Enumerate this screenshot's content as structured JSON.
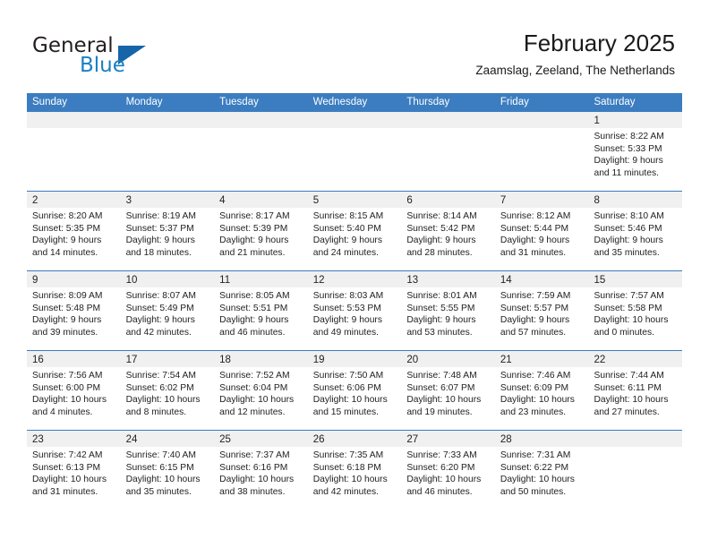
{
  "brand": {
    "name_top": "General",
    "name_bottom": "Blue",
    "triangle_color": "#1565a8",
    "blue_color": "#1b7fc4"
  },
  "header": {
    "title": "February 2025",
    "subtitle": "Zaamslag, Zeeland, The Netherlands"
  },
  "theme": {
    "header_bar_color": "#3b7dc0",
    "daynum_band_color": "#f0f0f0",
    "text_color": "#222222"
  },
  "weekday_headers": [
    "Sunday",
    "Monday",
    "Tuesday",
    "Wednesday",
    "Thursday",
    "Friday",
    "Saturday"
  ],
  "weeks": [
    [
      {
        "day": "",
        "sunrise": "",
        "sunset": "",
        "daylight_line1": "",
        "daylight_line2": ""
      },
      {
        "day": "",
        "sunrise": "",
        "sunset": "",
        "daylight_line1": "",
        "daylight_line2": ""
      },
      {
        "day": "",
        "sunrise": "",
        "sunset": "",
        "daylight_line1": "",
        "daylight_line2": ""
      },
      {
        "day": "",
        "sunrise": "",
        "sunset": "",
        "daylight_line1": "",
        "daylight_line2": ""
      },
      {
        "day": "",
        "sunrise": "",
        "sunset": "",
        "daylight_line1": "",
        "daylight_line2": ""
      },
      {
        "day": "",
        "sunrise": "",
        "sunset": "",
        "daylight_line1": "",
        "daylight_line2": ""
      },
      {
        "day": "1",
        "sunrise": "Sunrise: 8:22 AM",
        "sunset": "Sunset: 5:33 PM",
        "daylight_line1": "Daylight: 9 hours",
        "daylight_line2": "and 11 minutes."
      }
    ],
    [
      {
        "day": "2",
        "sunrise": "Sunrise: 8:20 AM",
        "sunset": "Sunset: 5:35 PM",
        "daylight_line1": "Daylight: 9 hours",
        "daylight_line2": "and 14 minutes."
      },
      {
        "day": "3",
        "sunrise": "Sunrise: 8:19 AM",
        "sunset": "Sunset: 5:37 PM",
        "daylight_line1": "Daylight: 9 hours",
        "daylight_line2": "and 18 minutes."
      },
      {
        "day": "4",
        "sunrise": "Sunrise: 8:17 AM",
        "sunset": "Sunset: 5:39 PM",
        "daylight_line1": "Daylight: 9 hours",
        "daylight_line2": "and 21 minutes."
      },
      {
        "day": "5",
        "sunrise": "Sunrise: 8:15 AM",
        "sunset": "Sunset: 5:40 PM",
        "daylight_line1": "Daylight: 9 hours",
        "daylight_line2": "and 24 minutes."
      },
      {
        "day": "6",
        "sunrise": "Sunrise: 8:14 AM",
        "sunset": "Sunset: 5:42 PM",
        "daylight_line1": "Daylight: 9 hours",
        "daylight_line2": "and 28 minutes."
      },
      {
        "day": "7",
        "sunrise": "Sunrise: 8:12 AM",
        "sunset": "Sunset: 5:44 PM",
        "daylight_line1": "Daylight: 9 hours",
        "daylight_line2": "and 31 minutes."
      },
      {
        "day": "8",
        "sunrise": "Sunrise: 8:10 AM",
        "sunset": "Sunset: 5:46 PM",
        "daylight_line1": "Daylight: 9 hours",
        "daylight_line2": "and 35 minutes."
      }
    ],
    [
      {
        "day": "9",
        "sunrise": "Sunrise: 8:09 AM",
        "sunset": "Sunset: 5:48 PM",
        "daylight_line1": "Daylight: 9 hours",
        "daylight_line2": "and 39 minutes."
      },
      {
        "day": "10",
        "sunrise": "Sunrise: 8:07 AM",
        "sunset": "Sunset: 5:49 PM",
        "daylight_line1": "Daylight: 9 hours",
        "daylight_line2": "and 42 minutes."
      },
      {
        "day": "11",
        "sunrise": "Sunrise: 8:05 AM",
        "sunset": "Sunset: 5:51 PM",
        "daylight_line1": "Daylight: 9 hours",
        "daylight_line2": "and 46 minutes."
      },
      {
        "day": "12",
        "sunrise": "Sunrise: 8:03 AM",
        "sunset": "Sunset: 5:53 PM",
        "daylight_line1": "Daylight: 9 hours",
        "daylight_line2": "and 49 minutes."
      },
      {
        "day": "13",
        "sunrise": "Sunrise: 8:01 AM",
        "sunset": "Sunset: 5:55 PM",
        "daylight_line1": "Daylight: 9 hours",
        "daylight_line2": "and 53 minutes."
      },
      {
        "day": "14",
        "sunrise": "Sunrise: 7:59 AM",
        "sunset": "Sunset: 5:57 PM",
        "daylight_line1": "Daylight: 9 hours",
        "daylight_line2": "and 57 minutes."
      },
      {
        "day": "15",
        "sunrise": "Sunrise: 7:57 AM",
        "sunset": "Sunset: 5:58 PM",
        "daylight_line1": "Daylight: 10 hours",
        "daylight_line2": "and 0 minutes."
      }
    ],
    [
      {
        "day": "16",
        "sunrise": "Sunrise: 7:56 AM",
        "sunset": "Sunset: 6:00 PM",
        "daylight_line1": "Daylight: 10 hours",
        "daylight_line2": "and 4 minutes."
      },
      {
        "day": "17",
        "sunrise": "Sunrise: 7:54 AM",
        "sunset": "Sunset: 6:02 PM",
        "daylight_line1": "Daylight: 10 hours",
        "daylight_line2": "and 8 minutes."
      },
      {
        "day": "18",
        "sunrise": "Sunrise: 7:52 AM",
        "sunset": "Sunset: 6:04 PM",
        "daylight_line1": "Daylight: 10 hours",
        "daylight_line2": "and 12 minutes."
      },
      {
        "day": "19",
        "sunrise": "Sunrise: 7:50 AM",
        "sunset": "Sunset: 6:06 PM",
        "daylight_line1": "Daylight: 10 hours",
        "daylight_line2": "and 15 minutes."
      },
      {
        "day": "20",
        "sunrise": "Sunrise: 7:48 AM",
        "sunset": "Sunset: 6:07 PM",
        "daylight_line1": "Daylight: 10 hours",
        "daylight_line2": "and 19 minutes."
      },
      {
        "day": "21",
        "sunrise": "Sunrise: 7:46 AM",
        "sunset": "Sunset: 6:09 PM",
        "daylight_line1": "Daylight: 10 hours",
        "daylight_line2": "and 23 minutes."
      },
      {
        "day": "22",
        "sunrise": "Sunrise: 7:44 AM",
        "sunset": "Sunset: 6:11 PM",
        "daylight_line1": "Daylight: 10 hours",
        "daylight_line2": "and 27 minutes."
      }
    ],
    [
      {
        "day": "23",
        "sunrise": "Sunrise: 7:42 AM",
        "sunset": "Sunset: 6:13 PM",
        "daylight_line1": "Daylight: 10 hours",
        "daylight_line2": "and 31 minutes."
      },
      {
        "day": "24",
        "sunrise": "Sunrise: 7:40 AM",
        "sunset": "Sunset: 6:15 PM",
        "daylight_line1": "Daylight: 10 hours",
        "daylight_line2": "and 35 minutes."
      },
      {
        "day": "25",
        "sunrise": "Sunrise: 7:37 AM",
        "sunset": "Sunset: 6:16 PM",
        "daylight_line1": "Daylight: 10 hours",
        "daylight_line2": "and 38 minutes."
      },
      {
        "day": "26",
        "sunrise": "Sunrise: 7:35 AM",
        "sunset": "Sunset: 6:18 PM",
        "daylight_line1": "Daylight: 10 hours",
        "daylight_line2": "and 42 minutes."
      },
      {
        "day": "27",
        "sunrise": "Sunrise: 7:33 AM",
        "sunset": "Sunset: 6:20 PM",
        "daylight_line1": "Daylight: 10 hours",
        "daylight_line2": "and 46 minutes."
      },
      {
        "day": "28",
        "sunrise": "Sunrise: 7:31 AM",
        "sunset": "Sunset: 6:22 PM",
        "daylight_line1": "Daylight: 10 hours",
        "daylight_line2": "and 50 minutes."
      },
      {
        "day": "",
        "sunrise": "",
        "sunset": "",
        "daylight_line1": "",
        "daylight_line2": ""
      }
    ]
  ]
}
